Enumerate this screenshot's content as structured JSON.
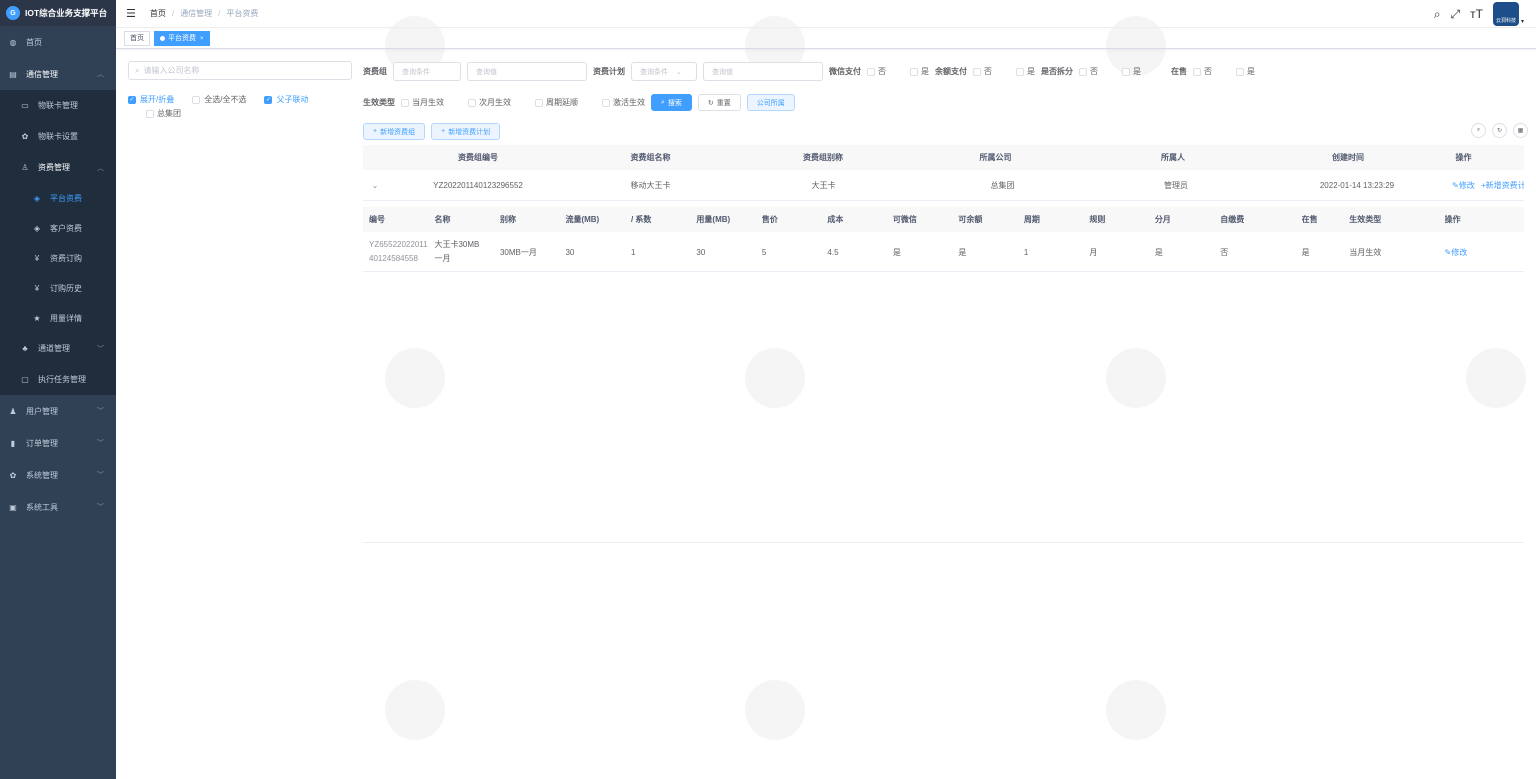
{
  "app": {
    "title": "IOT综合业务支撑平台"
  },
  "sidebar": {
    "items": [
      {
        "label": "首页",
        "icon": "dashboard-icon"
      },
      {
        "label": "通信管理",
        "icon": "layout-icon"
      },
      {
        "label": "物联卡管理",
        "icon": "card-icon"
      },
      {
        "label": "物联卡设置",
        "icon": "gear-icon"
      },
      {
        "label": "资费管理",
        "icon": "user-tie-icon"
      },
      {
        "label": "平台资费",
        "icon": "shield-icon"
      },
      {
        "label": "客户资费",
        "icon": "shield-icon"
      },
      {
        "label": "资费订购",
        "icon": "yen-icon"
      },
      {
        "label": "订购历史",
        "icon": "yen-icon"
      },
      {
        "label": "用量详情",
        "icon": "star-icon"
      },
      {
        "label": "通道管理",
        "icon": "tree-icon"
      },
      {
        "label": "执行任务管理",
        "icon": "monitor-icon"
      },
      {
        "label": "用户管理",
        "icon": "user-icon"
      },
      {
        "label": "订单管理",
        "icon": "chart-icon"
      },
      {
        "label": "系统管理",
        "icon": "gear-icon"
      },
      {
        "label": "系统工具",
        "icon": "toolbox-icon"
      }
    ]
  },
  "breadcrumb": [
    "首页",
    "通信管理",
    "平台资费"
  ],
  "tags": {
    "home": "首页",
    "current": "平台资费"
  },
  "navbar": {
    "avatar_text": "云洞科技"
  },
  "tree": {
    "search_placeholder": "请输入公司名称",
    "opt_expand": "展开/折叠",
    "opt_all": "全选/全不选",
    "opt_link": "父子联动",
    "node": "总集团"
  },
  "form": {
    "group_label": "资费组",
    "group_cond": "查询条件",
    "group_val": "查询值",
    "plan_label": "资费计划",
    "plan_cond": "查询条件",
    "plan_val": "查询值",
    "wechat_label": "微信支付",
    "balance_label": "余额支付",
    "split_label": "是否拆分",
    "onsale_label": "在售",
    "no": "否",
    "yes": "是",
    "effect_label": "生效类型",
    "eff_opts": [
      "当月生效",
      "次月生效",
      "周期延顺",
      "激活生效"
    ],
    "search_btn": "搜索",
    "reset_btn": "重置",
    "company_btn": "公司所属",
    "add_group_btn": "新增资费组",
    "add_plan_btn": "新增资费计划"
  },
  "group_table": {
    "headers": [
      "资费组编号",
      "资费组名称",
      "资费组别称",
      "所属公司",
      "所属人",
      "创建时间",
      "操作"
    ],
    "row": {
      "id": "YZ202201140123296552",
      "name": "移动大王卡",
      "alias": "大王卡",
      "company": "总集团",
      "owner": "管理员",
      "created": "2022-01-14 13:23:29",
      "edit": "修改",
      "add_plan": "新增资费计划"
    }
  },
  "plan_table": {
    "headers": [
      "编号",
      "名称",
      "别称",
      "流量(MB)",
      "/ 系数",
      "用量(MB)",
      "售价",
      "成本",
      "可微信",
      "可余额",
      "周期",
      "规则",
      "分月",
      "自缴费",
      "在售",
      "生效类型",
      "操作"
    ],
    "row": {
      "id_line1": "YZ65522022011",
      "id_line2": "40124584558",
      "name_line1": "大王卡30MB",
      "name_line2": "一月",
      "alias": "30MB一月",
      "flow": "30",
      "factor": "1",
      "usage": "30",
      "price": "5",
      "cost": "4.5",
      "wechat": "是",
      "balance": "是",
      "cycle": "1",
      "rule": "月",
      "split": "是",
      "self_pay": "否",
      "on_sale": "是",
      "effect": "当月生效",
      "edit": "修改"
    }
  }
}
